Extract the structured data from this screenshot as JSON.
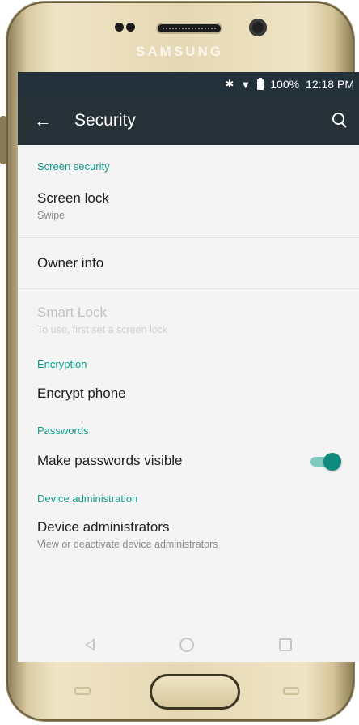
{
  "device": {
    "brand": "SAMSUNG"
  },
  "status_bar": {
    "battery": "100%",
    "time": "12:18 PM",
    "icons": [
      "bluetooth-icon",
      "wifi-icon",
      "battery-icon"
    ]
  },
  "app_bar": {
    "title": "Security",
    "back_icon": "arrow-back-icon",
    "search_icon": "search-icon"
  },
  "sections": {
    "screen_security": {
      "header": "Screen security",
      "screen_lock": {
        "title": "Screen lock",
        "summary": "Swipe"
      },
      "owner_info": {
        "title": "Owner info"
      },
      "smart_lock": {
        "title": "Smart Lock",
        "summary": "To use, first set a screen lock"
      }
    },
    "encryption": {
      "header": "Encryption",
      "encrypt_phone": {
        "title": "Encrypt phone"
      }
    },
    "passwords": {
      "header": "Passwords",
      "make_visible": {
        "title": "Make passwords visible",
        "enabled": true
      }
    },
    "device_administration": {
      "header": "Device administration",
      "device_admins": {
        "title": "Device administrators",
        "summary": "View or deactivate device administrators"
      }
    }
  },
  "colors": {
    "app_bar": "#263238",
    "status_bar": "#22313a",
    "accent": "#129c8c",
    "toggle_on": "#0f8a7d"
  }
}
